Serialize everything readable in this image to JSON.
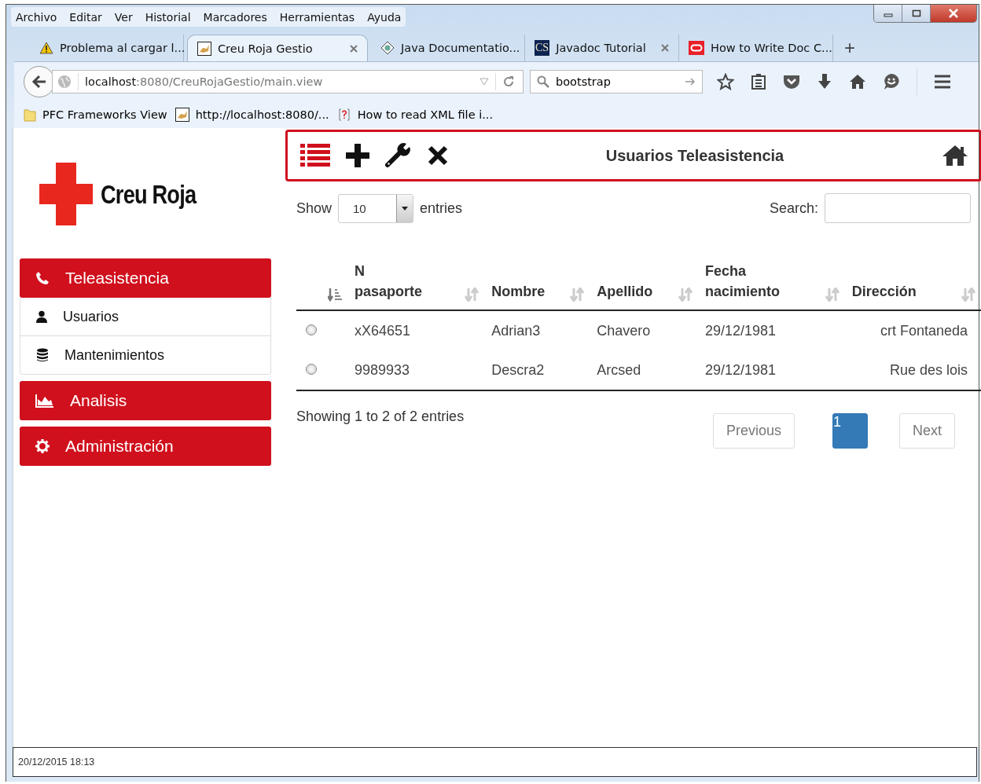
{
  "menu": [
    "Archivo",
    "Editar",
    "Ver",
    "Historial",
    "Marcadores",
    "Herramientas",
    "Ayuda"
  ],
  "tabs": [
    {
      "label": "Problema al cargar l...",
      "selected": false
    },
    {
      "label": "Creu Roja Gestio",
      "selected": true
    },
    {
      "label": "Java Documentatio...",
      "selected": false
    },
    {
      "label": "Javadoc Tutorial",
      "icon_text": "CS",
      "selected": false
    },
    {
      "label": "How to Write Doc C...",
      "selected": false
    }
  ],
  "new_tab": "+",
  "address": {
    "host": "localhost",
    "path": ":8080/CreuRojaGestio/main.view"
  },
  "search": {
    "value": "bootstrap"
  },
  "bookmarks": [
    {
      "label": "PFC Frameworks View"
    },
    {
      "label": "http://localhost:8080/..."
    },
    {
      "label": "How to read XML file i..."
    }
  ],
  "logo": {
    "text": "Creu Roja"
  },
  "sidebar": [
    {
      "kind": "section",
      "label": "Teleasistencia"
    },
    {
      "kind": "item",
      "label": "Usuarios"
    },
    {
      "kind": "item",
      "label": "Mantenimientos"
    },
    {
      "kind": "section",
      "label": "Analisis"
    },
    {
      "kind": "section",
      "label": "Administración"
    }
  ],
  "toolbar": {
    "title": "Usuarios Teleasistencia"
  },
  "length": {
    "before": "Show",
    "value": "10",
    "after": "entries"
  },
  "search_label": "Search:",
  "table": {
    "columns": [
      "N pasaporte",
      "Nombre",
      "Apellido",
      "Fecha nacimiento",
      "Dirección"
    ],
    "rows": [
      {
        "selected": false,
        "cells": [
          "xX64651",
          "Adrian3",
          "Chavero",
          "29/12/1981",
          "crt Fontaneda"
        ]
      },
      {
        "selected": false,
        "cells": [
          "9989933",
          "Descra2",
          "Arcsed",
          "29/12/1981",
          "Rue des lois"
        ]
      }
    ]
  },
  "info": "Showing 1 to 2 of 2 entries",
  "pagination": {
    "previous": {
      "label": "Previous",
      "disabled": true
    },
    "pages": [
      {
        "label": "1",
        "selected": true
      }
    ],
    "next": {
      "label": "Next",
      "disabled": true
    }
  },
  "status_bar": {
    "text": "20/12/2015 18:13"
  }
}
